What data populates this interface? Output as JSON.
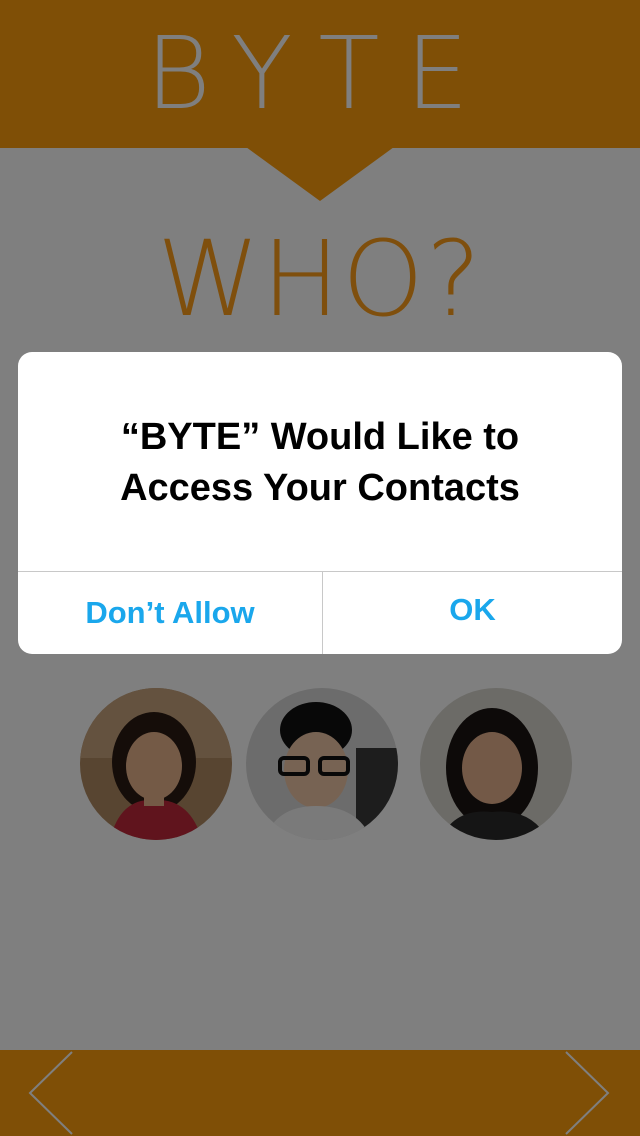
{
  "app": {
    "logo_text": "BYTE",
    "question": "WHO?",
    "avatars": [
      {
        "name": "avatar-1",
        "icon": "person-photo"
      },
      {
        "name": "avatar-2",
        "icon": "person-photo"
      },
      {
        "name": "avatar-3",
        "icon": "person-photo"
      }
    ],
    "nav": {
      "left_icon": "chevron-left-icon",
      "right_icon": "chevron-right-icon"
    },
    "colors": {
      "brand": "#ff9f0d",
      "question": "#ff9f1a"
    }
  },
  "alert": {
    "line1": "“BYTE” Would Like to",
    "line2": "Access Your Contacts",
    "deny_label": "Don’t Allow",
    "ok_label": "OK",
    "button_color": "#1aa7ec"
  }
}
